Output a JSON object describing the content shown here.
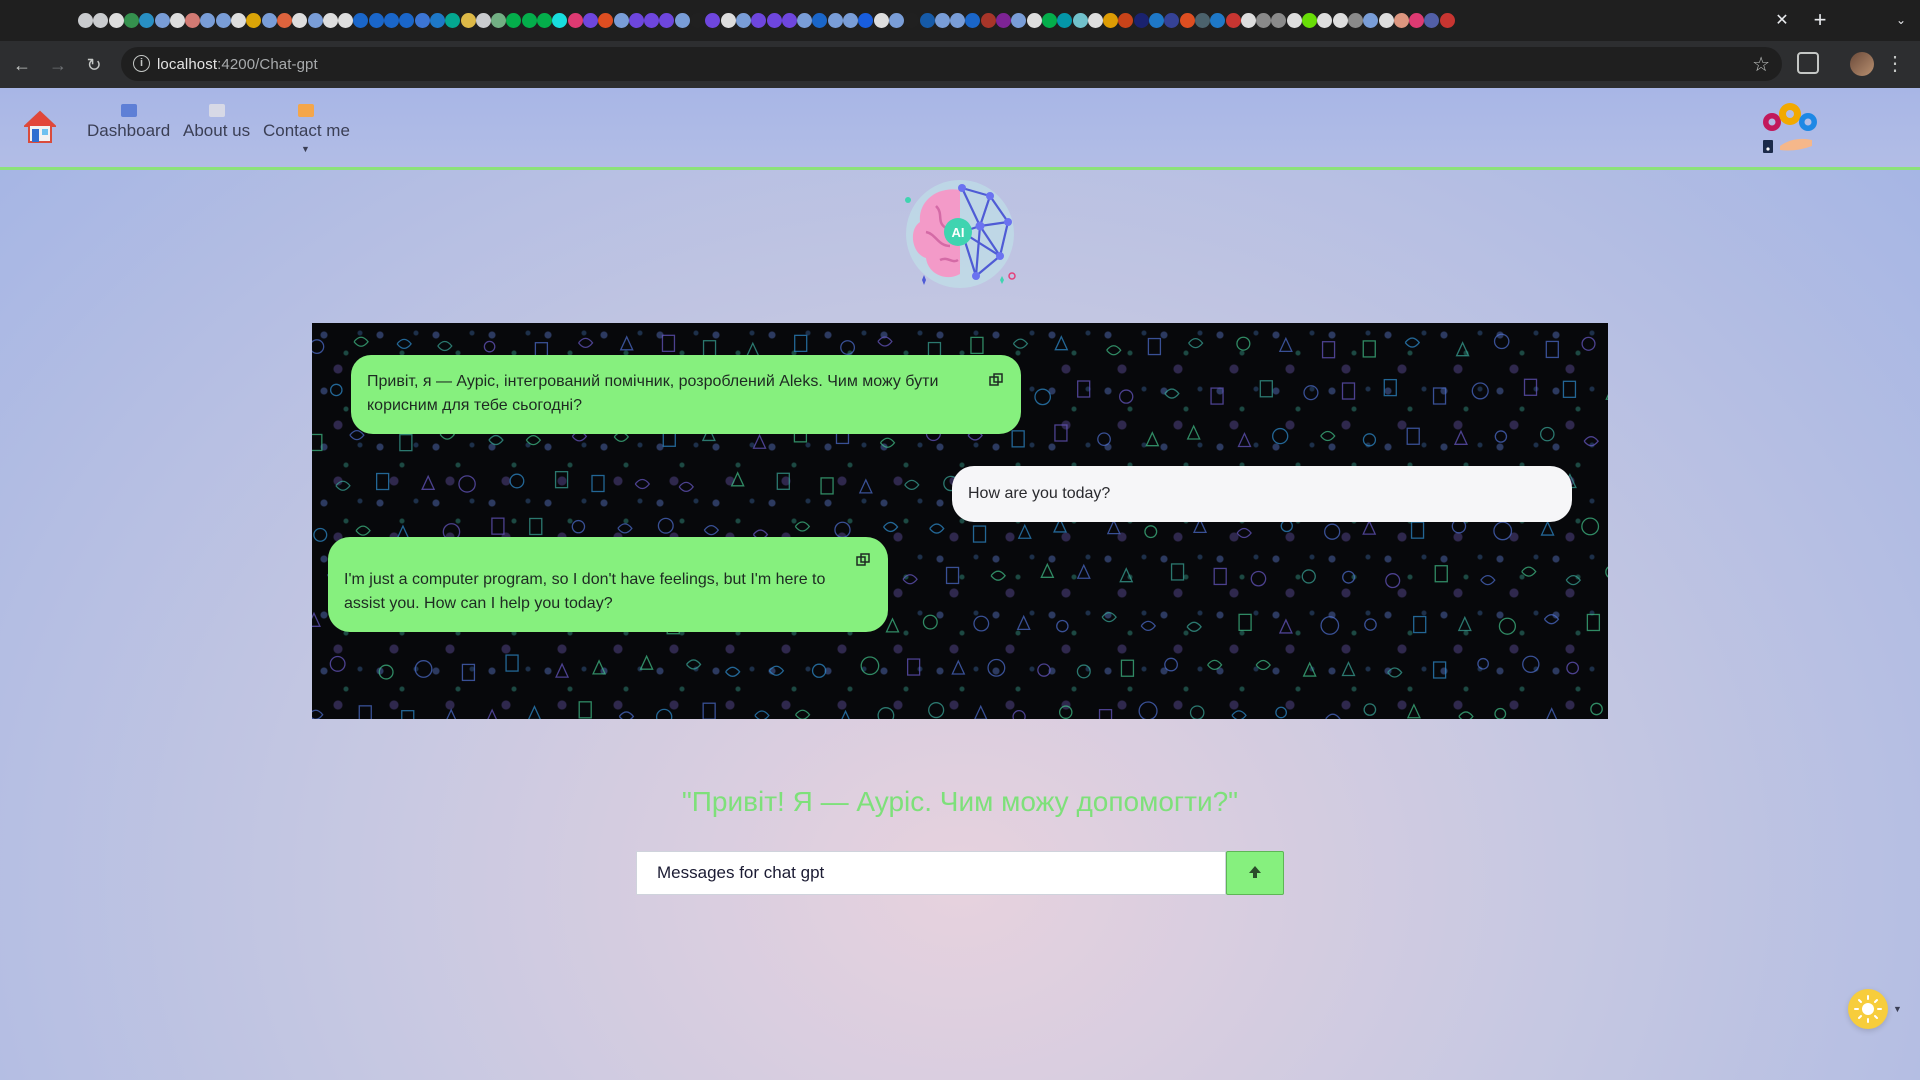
{
  "browser": {
    "url_host": "localhost",
    "url_path": ":4200/Chat-gpt",
    "close_tab_glyph": "✕",
    "new_tab_glyph": "+",
    "tab_search_glyph": "⌄",
    "back_glyph": "←",
    "forward_glyph": "→",
    "reload_glyph": "↻",
    "info_glyph": "i",
    "bookmark_glyph": "☆",
    "menu_glyph": "⋮",
    "tab_favicon_colors": [
      "#e8eaed",
      "#e8eaed",
      "#ffffff",
      "#3aa657",
      "#2aa3e0",
      "#8ab4f8",
      "#ffffff",
      "#f28b82",
      "#8ab4f8",
      "#8ab4f8",
      "#ffffff",
      "#fbbc04",
      "#8ab4f8",
      "#ff7043",
      "#ffffff",
      "#8ab4f8",
      "#ffffff",
      "#ffffff",
      "#1a73e8",
      "#1a73e8",
      "#1a73e8",
      "#1a73e8",
      "#4285f4",
      "#1e88e5",
      "#00bfa5",
      "#ffd54f",
      "#e8eaed",
      "#81c995",
      "#00c853",
      "#00c853",
      "#00c853",
      "#18ffff",
      "#ff4081",
      "#7c4dff",
      "#ff5722",
      "#8ab4f8",
      "#7c4dff",
      "#7c4dff",
      "#7c4dff",
      "#8ab4f8",
      "#212121",
      "#7c4dff",
      "#ffffff",
      "#8ab4f8",
      "#7c4dff",
      "#7c4dff",
      "#7c4dff",
      "#8ab4f8",
      "#1a73e8",
      "#8ab4f8",
      "#8ab4f8",
      "#1769ff",
      "#ffffff",
      "#8ab4f8",
      "#212121",
      "#1565c0",
      "#8ab4f8",
      "#8ab4f8",
      "#1a73e8",
      "#c0392b",
      "#8e24aa",
      "#8ab4f8",
      "#ffffff",
      "#00c853",
      "#00acc1",
      "#80deea",
      "#ffffff",
      "#ffb300",
      "#e64a19",
      "#1a237e",
      "#1e88e5",
      "#3949ab",
      "#ff5722",
      "#546e7a",
      "#1e88e5",
      "#e53935",
      "#ffffff",
      "#9e9e9e",
      "#9e9e9e",
      "#ffffff",
      "#76ff03",
      "#ffffff",
      "#ffffff",
      "#9e9e9e",
      "#8ab4f8",
      "#ffffff",
      "#ffab91",
      "#ff4081",
      "#5c6bc0",
      "#e53935"
    ]
  },
  "nav": {
    "items": [
      {
        "label": "Dashboard"
      },
      {
        "label": "About us"
      },
      {
        "label": "Contact me"
      }
    ],
    "dropdown_caret": "▼"
  },
  "chat": {
    "messages": [
      {
        "role": "assistant",
        "text": "Привіт, я — Ауріс, інтегрований помічник, розроблений Aleks. Чим можу бути корисним для тебе сьогодні?"
      },
      {
        "role": "user",
        "text": "How are you today?"
      },
      {
        "role": "assistant",
        "text": "I'm just a computer program, so I don't have feelings, but I'm here to assist you. How can I help you today?"
      }
    ]
  },
  "greeting": "\"Привіт! Я — Ауріс. Чим можу допомогти?\"",
  "input": {
    "value": "Messages for chat gpt",
    "placeholder": "Messages for chat gpt"
  },
  "logo_text": "AI",
  "theme_caret": "▼",
  "colors": {
    "accent_green": "#86f07e",
    "greeting_green": "#7ee07a",
    "nav_border": "#8ce27a",
    "theme_sun": "#f7cd3c"
  },
  "icons": {
    "home": "home-icon",
    "gear_logo": "gears-hand-icon",
    "ai_brain": "ai-brain-icon",
    "copy": "copy-icon",
    "send": "arrow-up-icon",
    "theme": "sun-icon"
  }
}
